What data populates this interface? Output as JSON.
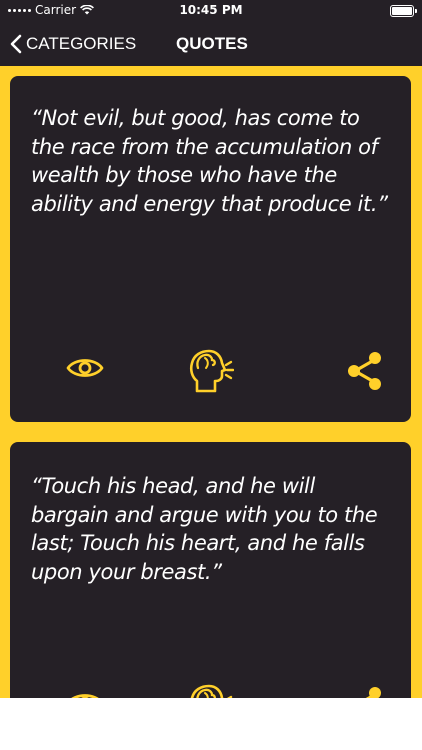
{
  "status_bar": {
    "carrier": "Carrier",
    "time": "10:45 PM"
  },
  "nav": {
    "back_label": "CATEGORIES",
    "title": "QUOTES"
  },
  "quotes": [
    {
      "text": "“Not evil, but good, has come to the race from the accumulation of wealth by those who have the ability and energy that produce it.”"
    },
    {
      "text": "“Touch his head, and he will bargain and argue with you to the last; Touch his heart, and he falls upon your breast.”"
    }
  ],
  "icons": {
    "view": "eye-icon",
    "speak": "speak-icon",
    "share": "share-icon"
  },
  "colors": {
    "accent": "#ffd02a",
    "card": "#252026",
    "text": "#ffffff"
  }
}
